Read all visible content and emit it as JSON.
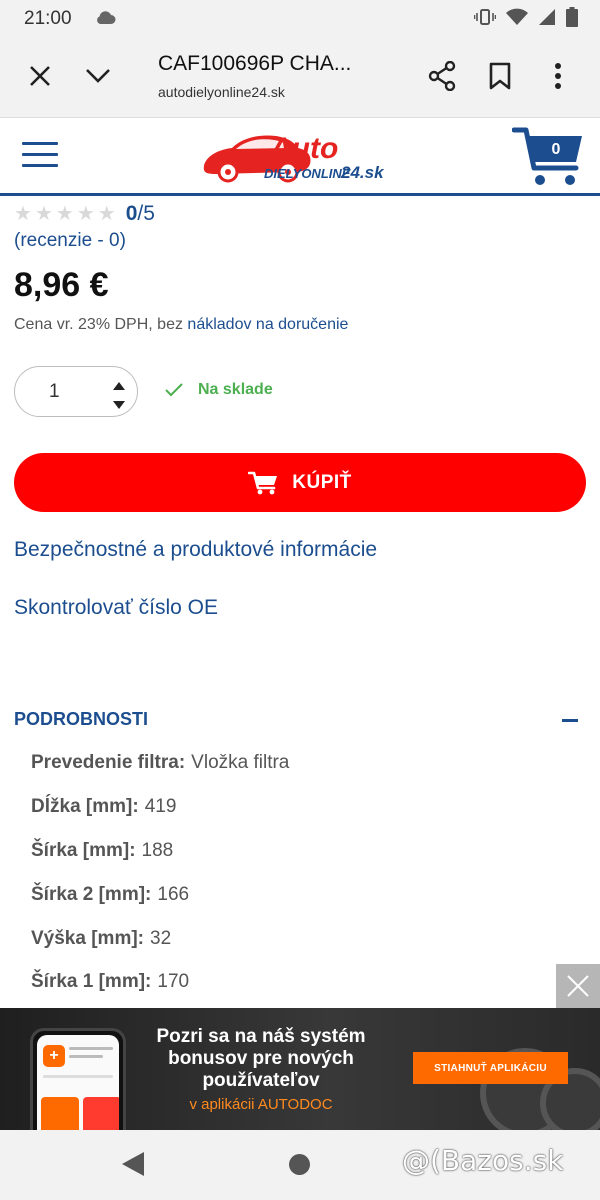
{
  "status_bar": {
    "time": "21:00"
  },
  "browser": {
    "page_title": "CAF100696P CHA...",
    "page_url": "autodielyonline24.sk",
    "close_icon": "close-icon",
    "expand_icon": "chevron-down-icon",
    "share_icon": "share-icon",
    "bookmark_icon": "bookmark-icon",
    "menu_icon": "more-vert-icon"
  },
  "site_header": {
    "logo_top": "Auto",
    "logo_bottom": "DIELYONLINE",
    "logo_suffix": "24.sk",
    "cart_count": "0",
    "brand_color": "#1c4e8f",
    "logo_red": "#e52421"
  },
  "product": {
    "rating_score": "0",
    "rating_max": "/5",
    "reviews_link": "(recenzie - 0)",
    "price": "8,96 €",
    "tax_note_prefix": "Cena vr. 23% DPH, bez ",
    "tax_note_link": "nákladov na doručenie",
    "quantity": "1",
    "stock_status": "Na sklade",
    "stock_color": "#4caf50",
    "buy_label": "KÚPIŤ",
    "buy_color": "#ff0000"
  },
  "links": {
    "safety_info": "Bezpečnostné a produktové informácie",
    "check_oe": "Skontrolovať číslo OE"
  },
  "details": {
    "title": "PODROBNOSTI",
    "specs": [
      {
        "key": "Prevedenie filtra:",
        "value": "Vložka filtra"
      },
      {
        "key": "Dĺžka [mm]:",
        "value": "419"
      },
      {
        "key": "Šírka [mm]:",
        "value": "188"
      },
      {
        "key": "Šírka 2 [mm]:",
        "value": "166"
      },
      {
        "key": "Výška [mm]:",
        "value": "32"
      },
      {
        "key": "Šírka 1 [mm]:",
        "value": "170"
      }
    ]
  },
  "ad": {
    "headline": "Pozri sa na náš systém bonusov pre nových používateľov",
    "subline": "v aplikácii AUTODOC",
    "cta": "STIAHNUŤ APLIKÁCIU",
    "accent": "#ff6a00"
  },
  "watermark": "@(Bazos.sk"
}
